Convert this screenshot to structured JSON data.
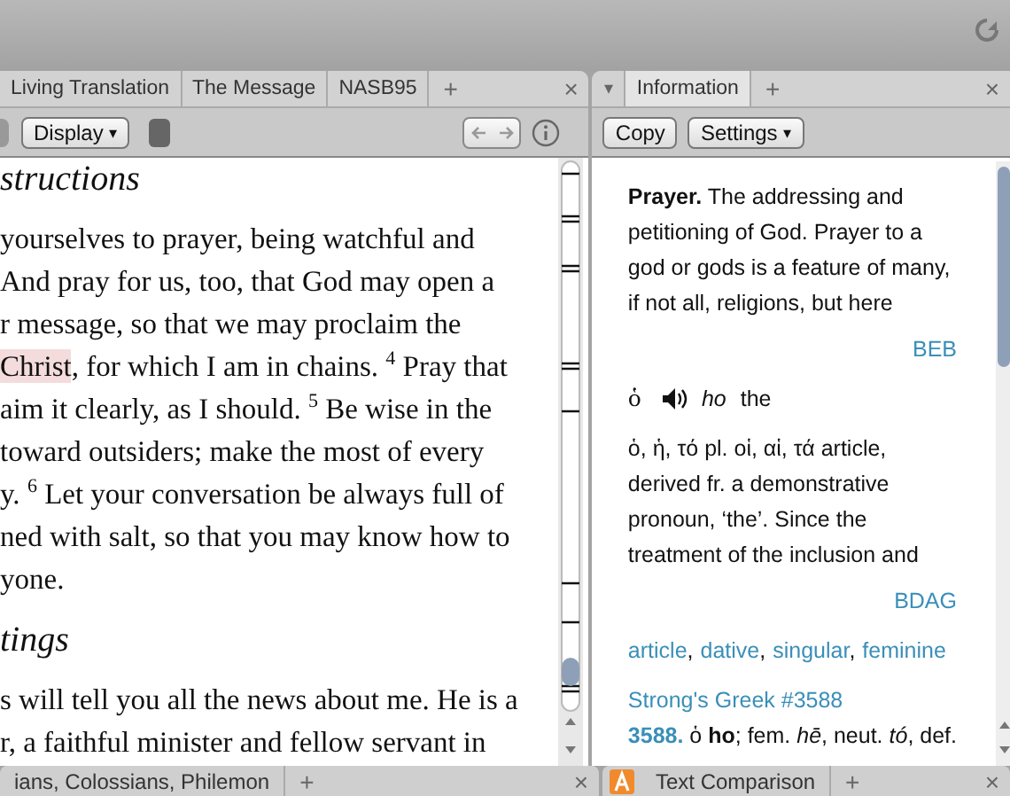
{
  "left_pane": {
    "tabs": [
      {
        "label": "Living Translation",
        "selected": false
      },
      {
        "label": "The Message",
        "selected": false
      },
      {
        "label": "NASB95",
        "selected": false
      }
    ],
    "new_tab": "+",
    "close": "×",
    "toolbar": {
      "display_button": "Display",
      "display_caret": "▾"
    },
    "sections": [
      {
        "heading": "structions",
        "lines": [
          [
            {
              "text": "yourselves to prayer, being watchful and",
              "highlighted": false
            }
          ],
          [
            {
              "text": "And pray for us, too, that God may open a",
              "highlighted": false
            }
          ],
          [
            {
              "text": "r message, so that we may proclaim the",
              "highlighted": false
            }
          ],
          [
            {
              "text": "Christ",
              "highlighted": true
            },
            {
              "text": ", for which I am in chains. $^{4}$ Pray that",
              "highlighted": false
            }
          ],
          [
            {
              "text": "aim it clearly, as I should. $^{5}$ Be wise in the",
              "highlighted": false
            }
          ],
          [
            {
              "text": " toward outsiders; make the most of every",
              "highlighted": false
            }
          ],
          [
            {
              "text": "y. $^{6}$ Let your conversation be always full of",
              "highlighted": false
            }
          ],
          [
            {
              "text": "ned with salt, so that you may know how to",
              "highlighted": false
            }
          ],
          [
            {
              "text": "yone.",
              "highlighted": false
            }
          ]
        ]
      },
      {
        "heading": "tings",
        "lines": [
          [
            {
              "text": "s will tell you all the news about me. He is a",
              "highlighted": false
            }
          ],
          [
            {
              "text": "r, a faithful minister and fellow servant in",
              "highlighted": false
            }
          ]
        ]
      }
    ],
    "bottom_tabs": [
      {
        "label": "ians, Colossians, Philemon",
        "selected": false
      }
    ],
    "bottom_new_tab": "+",
    "bottom_close": "×"
  },
  "right_pane": {
    "tabs": [
      {
        "label": "Information",
        "selected": true
      }
    ],
    "new_tab": "+",
    "close": "×",
    "tab_menu": "▾",
    "toolbar": {
      "copy_button": "Copy",
      "settings_button": "Settings",
      "settings_caret": "▾"
    },
    "entries": [
      {
        "kind": "article",
        "text": "**Prayer.** The addressing and petitioning of God. Prayer to a god or gods is a feature of many, if not all, religions, but here",
        "source": "BEB"
      },
      {
        "kind": "word",
        "lemma": "ὁ",
        "transliteration": "ho",
        "gloss": "the"
      },
      {
        "kind": "article",
        "text": "ὁ, ἡ, τό pl. οἱ, αἱ, τά article, derived fr. a demonstrative pronoun, ‘the’. Since the treatment of the inclusion and",
        "source": "BDAG"
      },
      {
        "kind": "tags",
        "links": [
          "article",
          "dative",
          "singular",
          "feminine"
        ],
        "separator": ","
      },
      {
        "kind": "strongs",
        "title": "Strong's Greek #3588",
        "text": "**3588.** ὁ **ho**; fem. *hē*, neut. *tó*, def."
      }
    ],
    "bottom_tabs": [
      {
        "label": "Text Comparison",
        "selected": false
      }
    ],
    "bottom_new_tab": "+",
    "bottom_close": "×"
  }
}
